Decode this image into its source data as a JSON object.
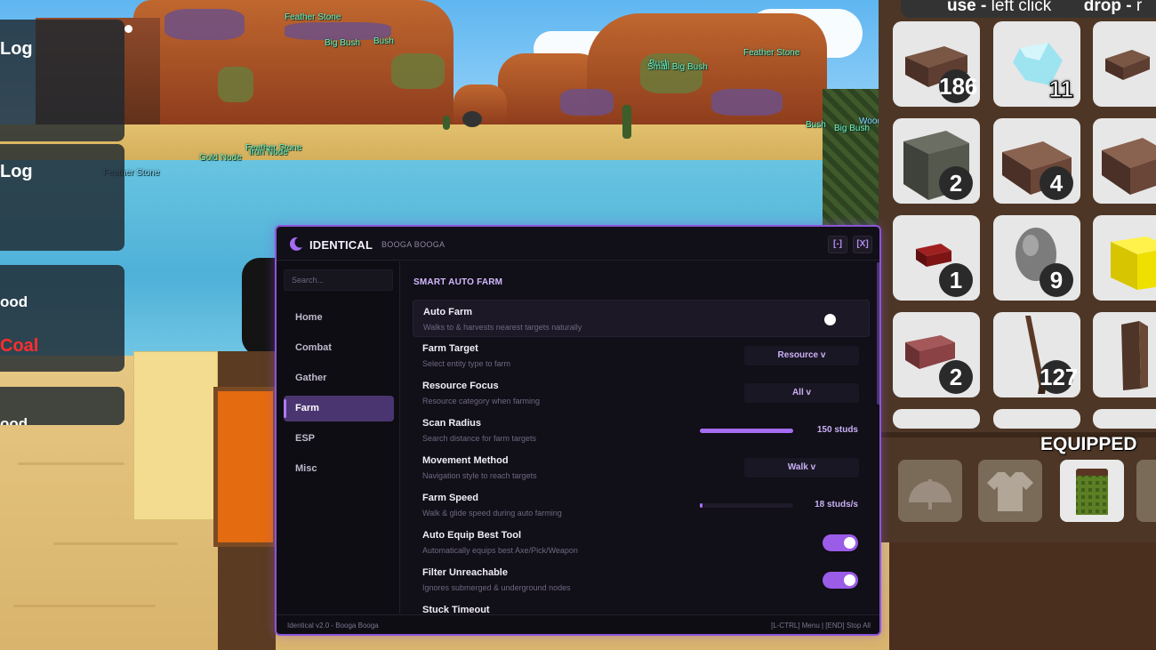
{
  "world": {
    "node_labels": [
      {
        "text": "Feather Stone",
        "color": "green"
      },
      {
        "text": "Big Bush",
        "color": "green"
      },
      {
        "text": "Bush",
        "color": "green"
      },
      {
        "text": "Bush",
        "color": "green"
      },
      {
        "text": "Small Big Bush",
        "color": "green"
      },
      {
        "text": "Feather Stone",
        "color": "green"
      },
      {
        "text": "Bush",
        "color": "green"
      },
      {
        "text": "Big Bush",
        "color": "green"
      },
      {
        "text": "Wood",
        "color": "blue"
      },
      {
        "text": "Feather Stone",
        "color": "green"
      },
      {
        "text": "Iron Node",
        "color": "green"
      },
      {
        "text": "Gold Node",
        "color": "green"
      },
      {
        "text": "Feather Stone",
        "color": "blue"
      }
    ]
  },
  "notifications": [
    {
      "text": "Log",
      "color": "#ffffff"
    },
    {
      "text": "Log",
      "color": "#ffffff"
    },
    {
      "text": "ood",
      "color": "#ffffff"
    },
    {
      "text": "Coal",
      "color": "#ff2d2d"
    },
    {
      "text": "ood",
      "color": "#ffffff"
    }
  ],
  "inventory": {
    "hint_use_key": "use -",
    "hint_use_action": "left click",
    "hint_drop_key": "drop -",
    "hint_drop_action": "r",
    "slots": [
      {
        "item": "wood-plank",
        "count": "186"
      },
      {
        "item": "crystal",
        "count": "11"
      },
      {
        "item": "wood-plank-small",
        "count": ""
      },
      {
        "item": "stone-block",
        "count": "2"
      },
      {
        "item": "wood-block",
        "count": "4"
      },
      {
        "item": "wood-block-large",
        "count": ""
      },
      {
        "item": "red-brick",
        "count": "1"
      },
      {
        "item": "egg",
        "count": "9"
      },
      {
        "item": "yellow-cube",
        "count": ""
      },
      {
        "item": "clay-brick",
        "count": "2"
      },
      {
        "item": "stick",
        "count": "127"
      },
      {
        "item": "log",
        "count": ""
      }
    ],
    "equipped_title": "EQUIPPED"
  },
  "menu": {
    "title": "IDENTICAL",
    "subtitle": "BOOGA BOOGA",
    "minimize_label": "[-]",
    "close_label": "[X]",
    "search_placeholder": "Search...",
    "nav": [
      {
        "label": "Home",
        "active": false
      },
      {
        "label": "Combat",
        "active": false
      },
      {
        "label": "Gather",
        "active": false
      },
      {
        "label": "Farm",
        "active": true
      },
      {
        "label": "ESP",
        "active": false
      },
      {
        "label": "Misc",
        "active": false
      }
    ],
    "section_title": "SMART AUTO FARM",
    "options": {
      "auto_farm": {
        "label": "Auto Farm",
        "desc": "Walks to & harvests nearest targets naturally",
        "enabled": false
      },
      "farm_target": {
        "label": "Farm Target",
        "desc": "Select entity type to farm",
        "value": "Resource v"
      },
      "resource_focus": {
        "label": "Resource Focus",
        "desc": "Resource category when farming",
        "value": "All v"
      },
      "scan_radius": {
        "label": "Scan Radius",
        "desc": "Search distance for farm targets",
        "value": "150 studs",
        "fill": 1.0
      },
      "movement_method": {
        "label": "Movement Method",
        "desc": "Navigation style to reach targets",
        "value": "Walk v"
      },
      "farm_speed": {
        "label": "Farm Speed",
        "desc": "Walk & glide speed during auto farming",
        "value": "18 studs/s",
        "fill": 0.03
      },
      "auto_equip": {
        "label": "Auto Equip Best Tool",
        "desc": "Automatically equips best Axe/Pick/Weapon",
        "enabled": true
      },
      "filter_unreachable": {
        "label": "Filter Unreachable",
        "desc": "Ignores submerged & underground nodes",
        "enabled": true
      },
      "stuck_timeout": {
        "label": "Stuck Timeout"
      }
    },
    "footer_left": "Identical v2.0 - Booga Booga",
    "footer_right": "[L-CTRL] Menu | [END] Stop All"
  }
}
